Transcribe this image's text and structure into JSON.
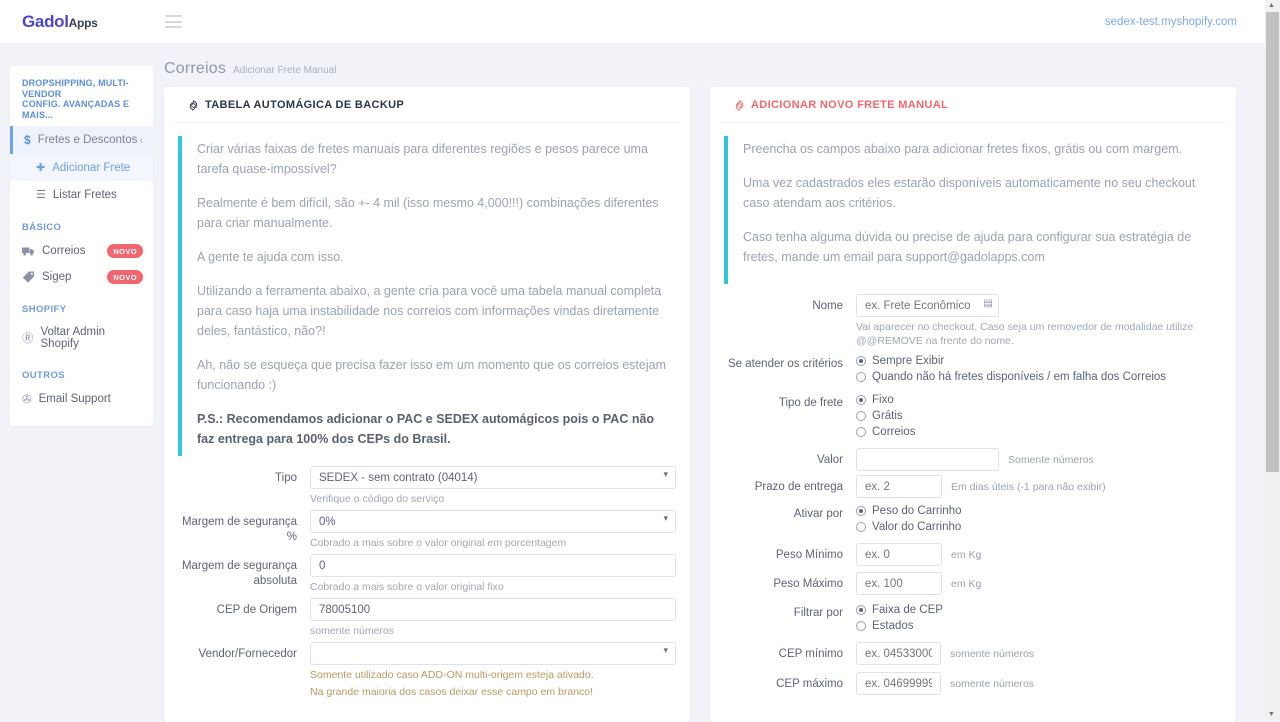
{
  "topbar": {
    "logo_main": "Gadol",
    "logo_sub": "Apps",
    "menu_icon": "hamburger-icon",
    "shop_link": "sedex-test.myshopify.com"
  },
  "sidebar": {
    "heading": "DROPSHIPPING, MULTI-VENDOR\nCONFIG. AVANÇADAS E MAIS...",
    "group": {
      "icon": "dollar-icon",
      "label": "Fretes e Descontos",
      "chevron": "‹"
    },
    "group_items": [
      {
        "icon": "plus-icon",
        "label": "Adicionar Frete",
        "active": true
      },
      {
        "icon": "list-icon",
        "label": "Listar Fretes",
        "active": false
      }
    ],
    "sections": [
      {
        "title": "BÁSICO",
        "items": [
          {
            "icon": "truck-icon",
            "label": "Correios",
            "badge": "NOVO"
          },
          {
            "icon": "tag-icon",
            "label": "Sigep",
            "badge": "NOVO"
          }
        ]
      },
      {
        "title": "SHOPIFY",
        "items": [
          {
            "icon": "registered-icon",
            "label": "Voltar Admin Shopify",
            "badge": ""
          }
        ]
      },
      {
        "title": "OUTROS",
        "items": [
          {
            "icon": "globe-icon",
            "label": "Email Support",
            "badge": ""
          }
        ]
      }
    ]
  },
  "page": {
    "title": "Correios",
    "subtitle": "Adicionar Frete Manual"
  },
  "left_card": {
    "header_icon": "gear-icon",
    "header": "TABELA AUTOMÁGICA DE BACKUP",
    "notice": [
      "Criar várias faixas de fretes manuais para diferentes regiões e pesos parece uma tarefa quase-impossível?",
      "Realmente é bem difícil, são +- 4 mil (isso mesmo 4,000!!!) combinações diferentes para criar manualmente.",
      "A gente te ajuda com isso.",
      "Utilizando a ferramenta abaixo, a gente cria para você uma tabela manual completa para caso haja uma instabilidade nos correios com informações vindas diretamente deles, fantástico, não?!",
      "Ah, não se esqueça que precisa fazer isso em um momento que os correios estejam funcionando :)"
    ],
    "notice_strong": "P.S.: Recomendamos adicionar o PAC e SEDEX automágicos pois o PAC não faz entrega para 100% dos CEPs do Brasil.",
    "fields": {
      "tipo_label": "Tipo",
      "tipo_value": "SEDEX - sem contrato (04014)",
      "tipo_hint": "Verifique o código do serviço",
      "margem_pct_label": "Margem de segurança %",
      "margem_pct_value": "0%",
      "margem_pct_hint": "Cobrado a mais sobre o valor original em porcentagem",
      "margem_abs_label": "Margem de segurança absoluta",
      "margem_abs_value": "0",
      "margem_abs_hint": "Cobrado a mais sobre o valor original fixo",
      "cep_label": "CEP de Origem",
      "cep_value": "78005100",
      "cep_hint": "somente números",
      "vendor_label": "Vendor/Fornecedor",
      "vendor_value": "",
      "vendor_hint_1": "Somente utilizado caso ADD-ON multi-origem esteja ativado.",
      "vendor_hint_2": "Na grande maioria dos casos deixar esse campo em branco!"
    }
  },
  "right_card": {
    "header_icon": "gear-icon",
    "header": "ADICIONAR NOVO FRETE MANUAL",
    "notice": [
      "Preencha os campos abaixo para adicionar fretes fixos, grátis ou com margem.",
      "Uma vez cadastrados eles estarão disponíveis automaticamente no seu checkout caso atendam aos critérios.",
      "Caso tenha alguma dúvida ou precise de ajuda para configurar sua estratégia de fretes, mande um email para support@gadolapps.com"
    ],
    "fields": {
      "nome_label": "Nome",
      "nome_placeholder": "ex. Frete Econômico",
      "nome_icon": "clipboard-icon",
      "nome_hint": "Vai aparecer no checkout. Caso seja um removedor de modalidae utilize @@REMOVE na frente do nome.",
      "criterios_label": "Se atender os critérios",
      "criterios_options": [
        {
          "label": "Sempre Exibir",
          "selected": true
        },
        {
          "label": "Quando não há fretes disponíveis / em falha dos Correios",
          "selected": false
        }
      ],
      "tipo_frete_label": "Tipo de frete",
      "tipo_frete_options": [
        {
          "label": "Fixo",
          "selected": true
        },
        {
          "label": "Grátis",
          "selected": false
        },
        {
          "label": "Correios",
          "selected": false
        }
      ],
      "valor_label": "Valor",
      "valor_value": "",
      "valor_note": "Somente números",
      "prazo_label": "Prazo de entrega",
      "prazo_placeholder": "ex. 2",
      "prazo_note": "Em dias úteis (-1 para não exibir)",
      "ativar_label": "Ativar por",
      "ativar_options": [
        {
          "label": "Peso do Carrinho",
          "selected": true
        },
        {
          "label": "Valor do Carrinho",
          "selected": false
        }
      ],
      "peso_min_label": "Peso Mínimo",
      "peso_min_placeholder": "ex. 0",
      "peso_min_note": "em Kg",
      "peso_max_label": "Peso Máximo",
      "peso_max_placeholder": "ex. 100",
      "peso_max_note": "em Kg",
      "filtrar_label": "Filtrar por",
      "filtrar_options": [
        {
          "label": "Faixa de CEP",
          "selected": true
        },
        {
          "label": "Estados",
          "selected": false
        }
      ],
      "cep_min_label": "CEP mínimo",
      "cep_min_placeholder": "ex. 04533000",
      "cep_min_note": "somente números",
      "cep_max_label": "CEP máximo",
      "cep_max_placeholder": "ex. 04699999",
      "cep_max_note": "somente números"
    }
  },
  "colors": {
    "accent_blue": "#5b8ede",
    "accent_teal": "#2ec8d6",
    "accent_red": "#f2666f",
    "logo_purple": "#4f46c9"
  }
}
